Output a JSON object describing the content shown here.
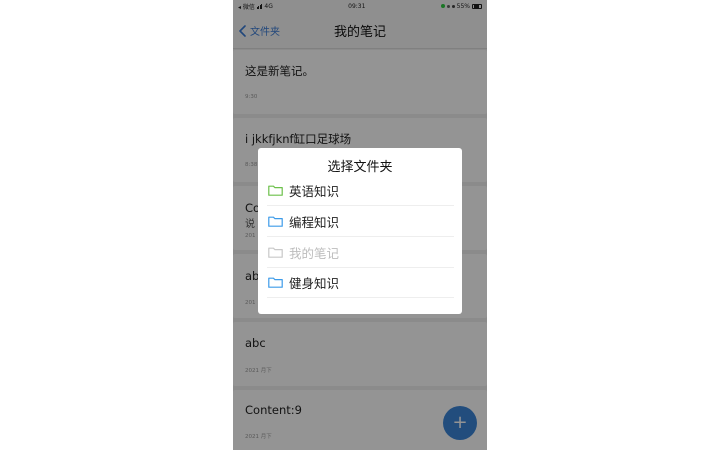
{
  "status_bar": {
    "carrier": "◂ 微信 ",
    "network": "4G",
    "time": "09:31",
    "battery": "55%"
  },
  "navbar": {
    "back_label": "文件夹",
    "title": "我的笔记"
  },
  "notes": [
    {
      "title": "这是新笔记。",
      "date": "9:30"
    },
    {
      "title": "i jkkfjknf缸口足球场",
      "date": "8:38"
    },
    {
      "title": "Co",
      "subtitle": "说",
      "date": "201"
    },
    {
      "title": "ab",
      "date": "201"
    },
    {
      "title": "abc",
      "date": "2021 月下"
    },
    {
      "title": "Content:9",
      "date": "2021 月下"
    }
  ],
  "fab": {
    "label": "+"
  },
  "dialog": {
    "title": "选择文件夹",
    "options": [
      {
        "label": "英语知识",
        "color": "#6cc04a",
        "disabled": false
      },
      {
        "label": "编程知识",
        "color": "#3d9be9",
        "disabled": false
      },
      {
        "label": "我的笔记",
        "color": "#c8c8c8",
        "disabled": true
      },
      {
        "label": "健身知识",
        "color": "#3d9be9",
        "disabled": false
      }
    ]
  },
  "colors": {
    "accent": "#3a7bd5",
    "fab": "#3b86d8"
  }
}
